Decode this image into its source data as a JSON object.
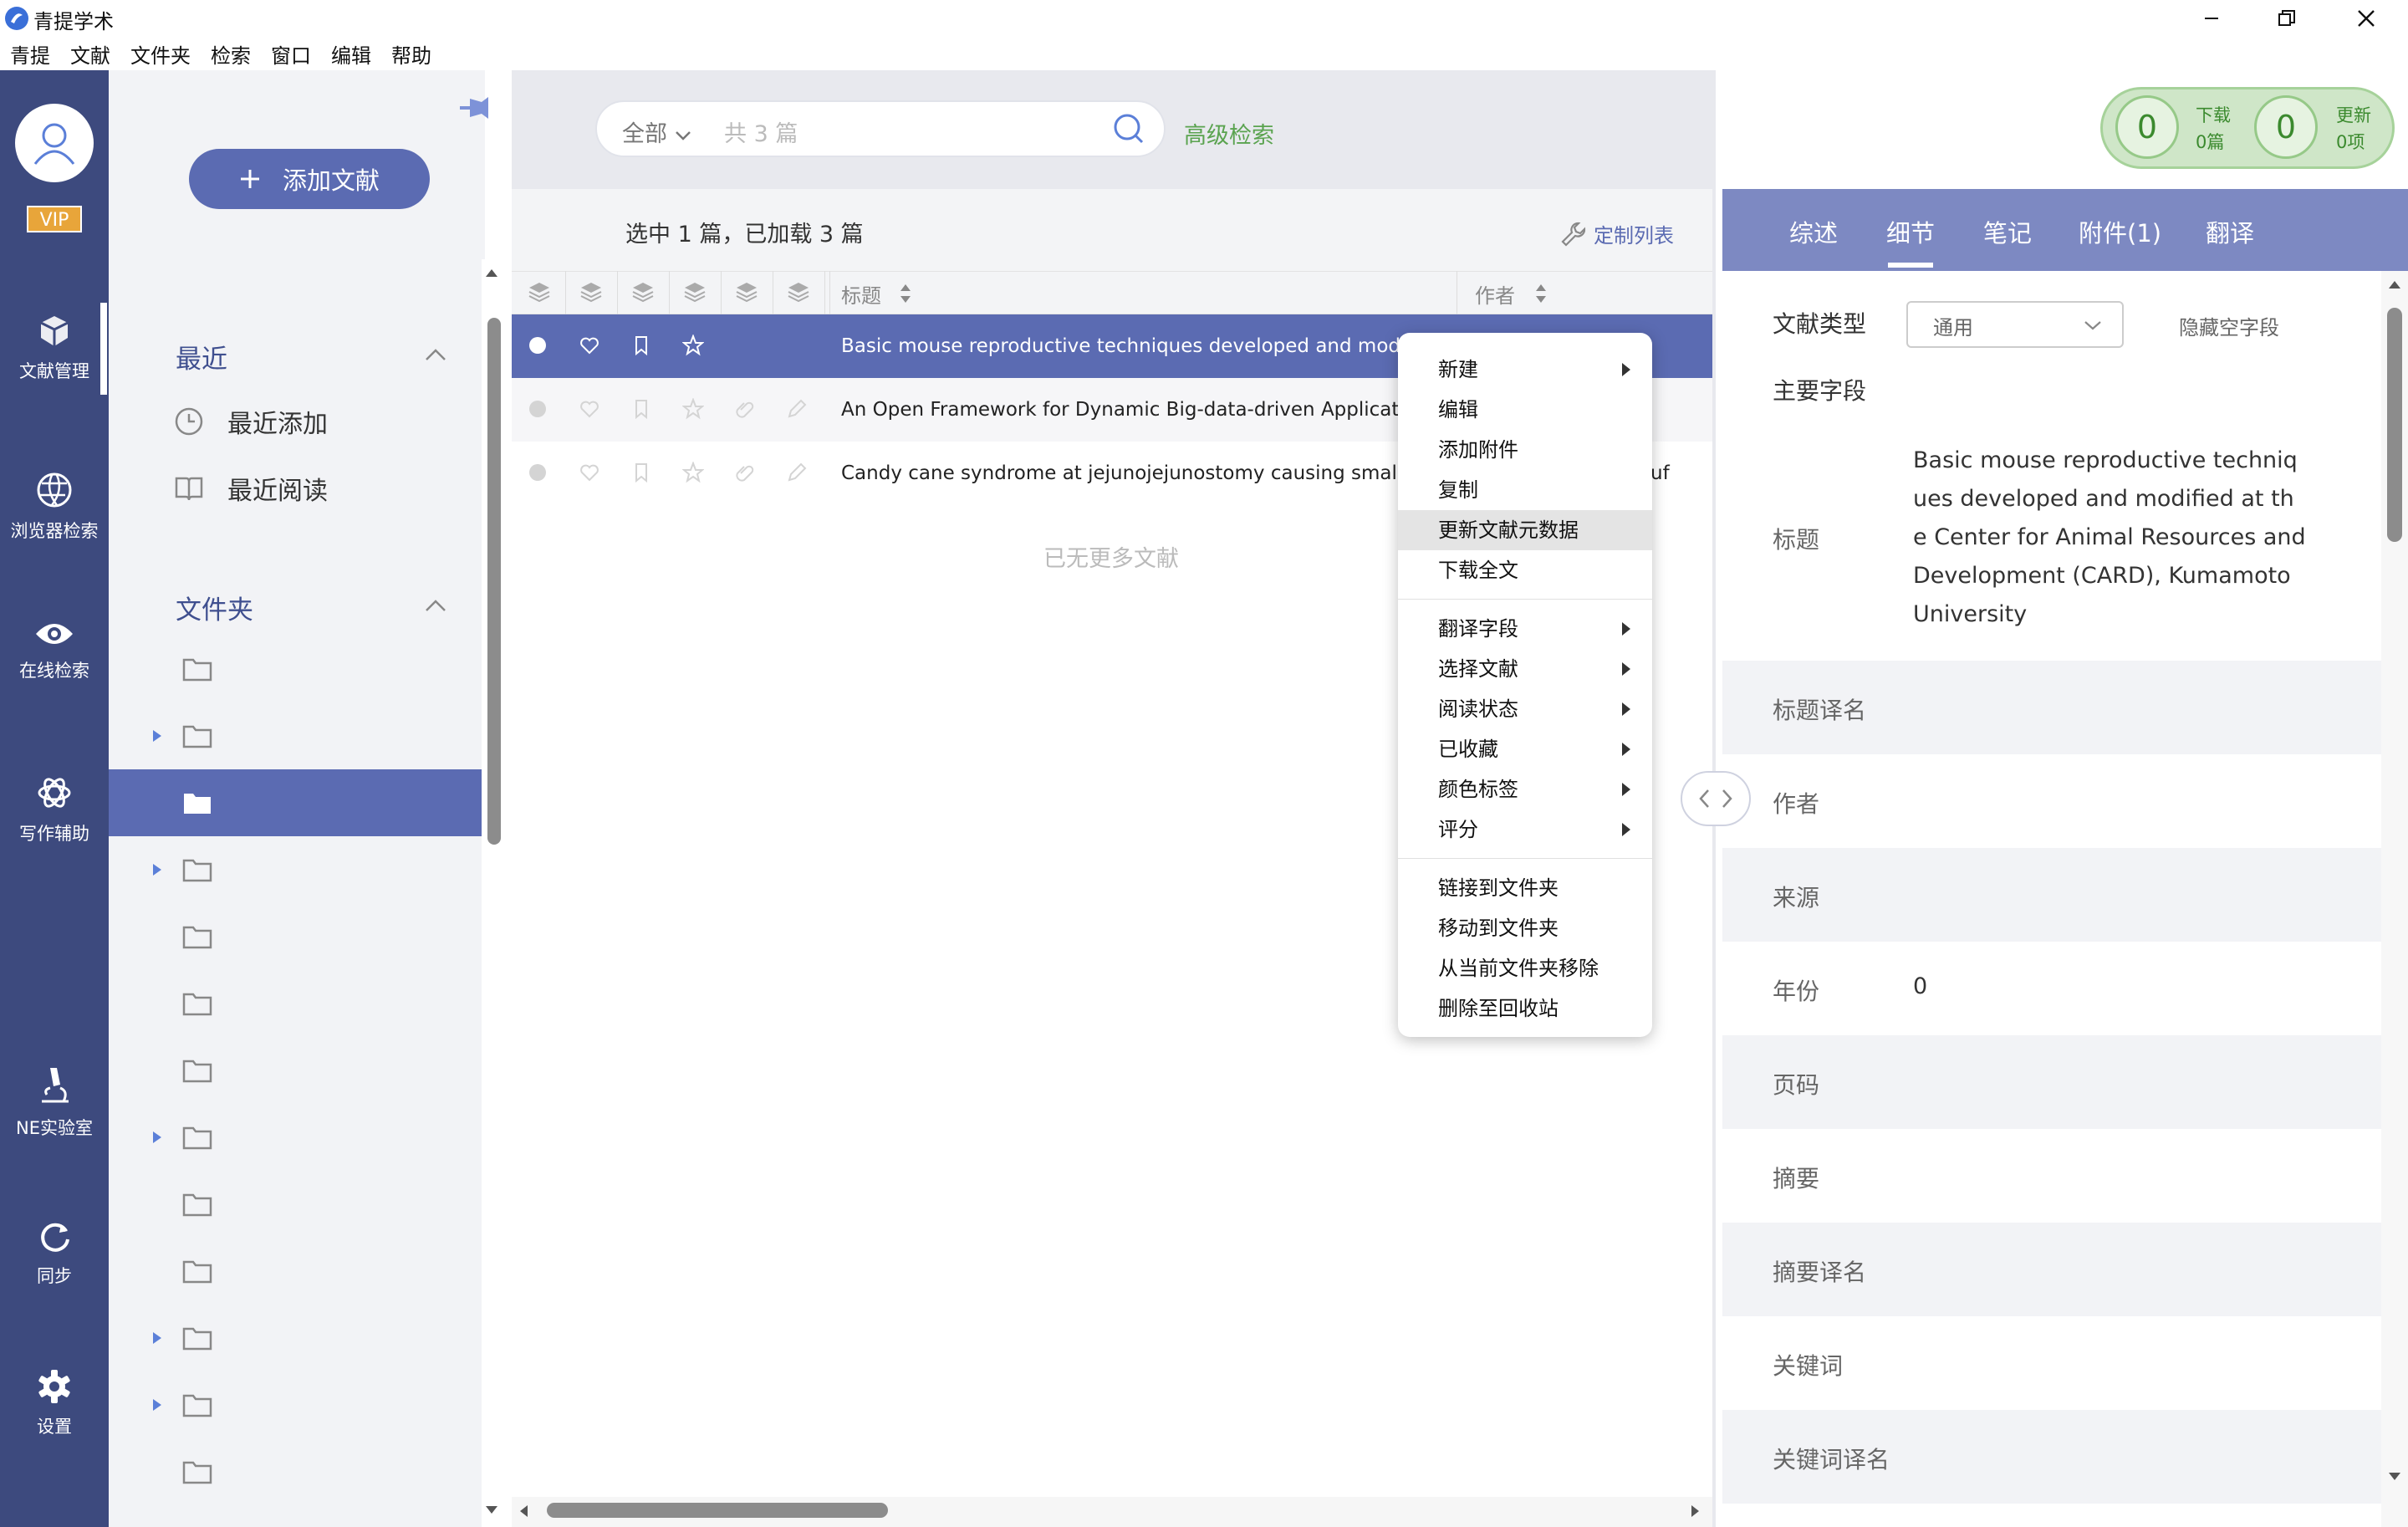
{
  "window": {
    "title": "青提学术",
    "logo_icon": "app-logo-icon",
    "controls": [
      "minimize-icon",
      "restore-icon",
      "close-icon"
    ]
  },
  "menubar": [
    "青提",
    "文献",
    "文件夹",
    "检索",
    "窗口",
    "编辑",
    "帮助"
  ],
  "leftnav": {
    "vip": "VIP",
    "items": [
      {
        "label": "文献管理",
        "icon": "cube-icon",
        "active": true
      },
      {
        "label": "浏览器检索",
        "icon": "globe-icon"
      },
      {
        "label": "在线检索",
        "icon": "eye-icon"
      },
      {
        "label": "写作辅助",
        "icon": "openai-icon"
      },
      {
        "label": "NE实验室",
        "icon": "microscope-icon"
      },
      {
        "label": "同步",
        "icon": "sync-icon"
      },
      {
        "label": "设置",
        "icon": "gear-icon"
      }
    ]
  },
  "sidebar": {
    "add_button": "添加文献",
    "recent": {
      "title": "最近",
      "items": [
        {
          "label": "最近添加",
          "icon": "clock-icon"
        },
        {
          "label": "最近阅读",
          "icon": "book-icon"
        }
      ]
    },
    "folders": {
      "title": "文件夹",
      "count": 13,
      "selected_index": 2,
      "expandable": [
        1,
        3,
        7,
        10,
        11
      ]
    }
  },
  "search": {
    "scope": "全部",
    "placeholder": "共 3 篇",
    "advanced": "高级检索"
  },
  "list": {
    "status": "选中 1 篇，已加载 3 篇",
    "customize": "定制列表",
    "columns": {
      "title": "标题",
      "author": "作者"
    },
    "rows": [
      {
        "title": "Basic mouse reproductive techniques developed and modified",
        "author": "",
        "selected": true
      },
      {
        "title": "An Open Framework for Dynamic Big-data-driven Application S",
        "author": "",
        "selected": false
      },
      {
        "title": "Candy cane syndrome at jejunojejunostomy causing small bow",
        "author": "uf",
        "selected": false
      }
    ],
    "no_more": "已无更多文献"
  },
  "context_menu": {
    "groups": [
      [
        {
          "label": "新建",
          "sub": true
        },
        {
          "label": "编辑"
        },
        {
          "label": "添加附件"
        },
        {
          "label": "复制"
        },
        {
          "label": "更新文献元数据",
          "highlight": true
        },
        {
          "label": "下载全文"
        }
      ],
      [
        {
          "label": "翻译字段",
          "sub": true
        },
        {
          "label": "选择文献",
          "sub": true
        },
        {
          "label": "阅读状态",
          "sub": true
        },
        {
          "label": "已收藏",
          "sub": true
        },
        {
          "label": "颜色标签",
          "sub": true
        },
        {
          "label": "评分",
          "sub": true
        }
      ],
      [
        {
          "label": "链接到文件夹"
        },
        {
          "label": "移动到文件夹"
        },
        {
          "label": "从当前文件夹移除"
        },
        {
          "label": "删除至回收站"
        }
      ]
    ]
  },
  "counters": {
    "download": {
      "value": "0",
      "label": "下载",
      "sub": "0篇"
    },
    "update": {
      "value": "0",
      "label": "更新",
      "sub": "0项"
    }
  },
  "detail": {
    "tabs": [
      "综述",
      "细节",
      "笔记",
      "附件(1)",
      "翻译"
    ],
    "active_tab": 1,
    "type_label": "文献类型",
    "type_value": "通用",
    "hide_empty": "隐藏空字段",
    "main_fields": "主要字段",
    "title_label": "标题",
    "title_value": "Basic mouse reproductive techniques developed and modified at the Center for Animal Resources and Development (CARD), Kumamoto University",
    "fields": [
      {
        "label": "标题译名",
        "value": ""
      },
      {
        "label": "作者",
        "value": ""
      },
      {
        "label": "来源",
        "value": ""
      },
      {
        "label": "年份",
        "value": "0"
      },
      {
        "label": "页码",
        "value": ""
      },
      {
        "label": "摘要",
        "value": ""
      },
      {
        "label": "摘要译名",
        "value": ""
      },
      {
        "label": "关键词",
        "value": ""
      },
      {
        "label": "关键词译名",
        "value": ""
      }
    ]
  },
  "colors": {
    "nav": "#3d4a7e",
    "accent": "#5b6bb2",
    "tabs": "#7d89c2",
    "green": "#5aa34f",
    "vip": "#e8a53a"
  }
}
